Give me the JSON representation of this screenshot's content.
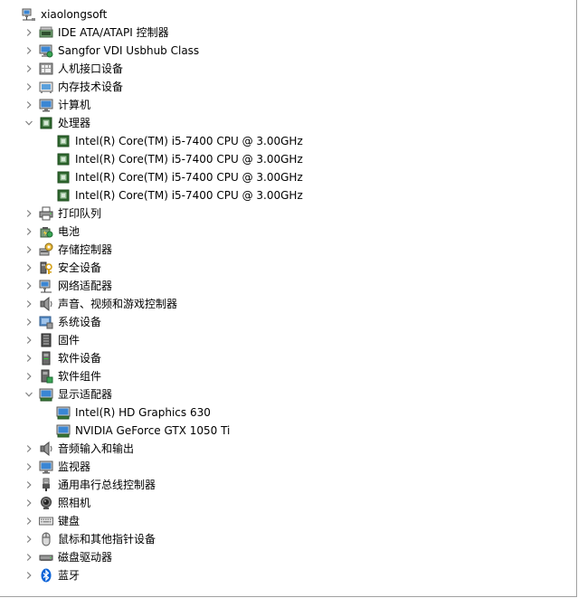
{
  "root": {
    "label": "xiaolongsoft",
    "icon": "computer-network-icon"
  },
  "categories": [
    {
      "label": "IDE ATA/ATAPI 控制器",
      "icon": "ide-controller-icon",
      "expanded": false
    },
    {
      "label": "Sangfor VDI Usbhub Class",
      "icon": "usb-hub-icon",
      "expanded": false
    },
    {
      "label": "人机接口设备",
      "icon": "hid-icon",
      "expanded": false
    },
    {
      "label": "内存技术设备",
      "icon": "memory-device-icon",
      "expanded": false
    },
    {
      "label": "计算机",
      "icon": "computer-icon",
      "expanded": false
    },
    {
      "label": "处理器",
      "icon": "processor-icon",
      "expanded": true,
      "children": [
        {
          "label": "Intel(R) Core(TM) i5-7400 CPU @ 3.00GHz",
          "icon": "processor-icon"
        },
        {
          "label": "Intel(R) Core(TM) i5-7400 CPU @ 3.00GHz",
          "icon": "processor-icon"
        },
        {
          "label": "Intel(R) Core(TM) i5-7400 CPU @ 3.00GHz",
          "icon": "processor-icon"
        },
        {
          "label": "Intel(R) Core(TM) i5-7400 CPU @ 3.00GHz",
          "icon": "processor-icon"
        }
      ]
    },
    {
      "label": "打印队列",
      "icon": "printer-icon",
      "expanded": false
    },
    {
      "label": "电池",
      "icon": "battery-icon",
      "expanded": false
    },
    {
      "label": "存储控制器",
      "icon": "storage-controller-icon",
      "expanded": false
    },
    {
      "label": "安全设备",
      "icon": "security-device-icon",
      "expanded": false
    },
    {
      "label": "网络适配器",
      "icon": "network-adapter-icon",
      "expanded": false
    },
    {
      "label": "声音、视频和游戏控制器",
      "icon": "speaker-icon",
      "expanded": false
    },
    {
      "label": "系统设备",
      "icon": "system-device-icon",
      "expanded": false
    },
    {
      "label": "固件",
      "icon": "firmware-icon",
      "expanded": false
    },
    {
      "label": "软件设备",
      "icon": "software-device-icon",
      "expanded": false
    },
    {
      "label": "软件组件",
      "icon": "software-component-icon",
      "expanded": false
    },
    {
      "label": "显示适配器",
      "icon": "display-adapter-icon",
      "expanded": true,
      "children": [
        {
          "label": "Intel(R) HD Graphics 630",
          "icon": "display-adapter-icon"
        },
        {
          "label": "NVIDIA GeForce GTX 1050 Ti",
          "icon": "display-adapter-icon"
        }
      ]
    },
    {
      "label": "音频输入和输出",
      "icon": "speaker-icon",
      "expanded": false
    },
    {
      "label": "监视器",
      "icon": "monitor-icon",
      "expanded": false
    },
    {
      "label": "通用串行总线控制器",
      "icon": "usb-plug-icon",
      "expanded": false
    },
    {
      "label": "照相机",
      "icon": "camera-icon",
      "expanded": false
    },
    {
      "label": "键盘",
      "icon": "keyboard-icon",
      "expanded": false
    },
    {
      "label": "鼠标和其他指针设备",
      "icon": "mouse-icon",
      "expanded": false
    },
    {
      "label": "磁盘驱动器",
      "icon": "disk-drive-icon",
      "expanded": false
    },
    {
      "label": "蓝牙",
      "icon": "bluetooth-icon",
      "expanded": false
    }
  ],
  "colors": {
    "chevron": "#808080",
    "chip_green": "#2f6e2f",
    "chip_inner": "#9fc59f",
    "screen_blue": "#3a86d4",
    "bluetooth_blue": "#0a63d8",
    "metal_gray": "#8a8a8a"
  }
}
